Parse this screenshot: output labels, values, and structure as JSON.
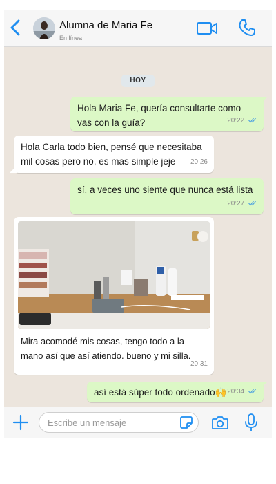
{
  "header": {
    "contact_name": "Alumna de Maria Fe",
    "status": "En línea"
  },
  "chat": {
    "date_chip": "HOY",
    "messages": [
      {
        "direction": "out",
        "text": "Hola Maria Fe, quería consultarte como vas con la guía?",
        "time": "20:22",
        "read": true
      },
      {
        "direction": "in",
        "text": "Hola Carla todo bien, pensé que necesitaba mil cosas pero no, es mas simple jeje",
        "time": "20:26"
      },
      {
        "direction": "out",
        "text": "sí, a veces uno siente que nunca está lista",
        "time": "20:27",
        "read": true
      },
      {
        "direction": "in",
        "type": "image",
        "caption": "Mira acomodé mis cosas, tengo todo a la mano así que así atiendo. bueno y mi silla.",
        "time": "20:31"
      },
      {
        "direction": "out",
        "text": "así está súper todo ordenado🙌",
        "time": "20:34",
        "read": true
      }
    ]
  },
  "composer": {
    "placeholder": "Escribe un mensaje"
  },
  "colors": {
    "accent": "#1f8ef1",
    "chat_background": "#ece5dd",
    "outgoing_bubble": "#dcf8c6",
    "incoming_bubble": "#ffffff",
    "read_tick": "#4fa3e0"
  },
  "icons": [
    "back-chevron-icon",
    "video-camera-icon",
    "phone-icon",
    "plus-icon",
    "sticker-icon",
    "camera-icon",
    "microphone-icon",
    "double-check-icon"
  ]
}
